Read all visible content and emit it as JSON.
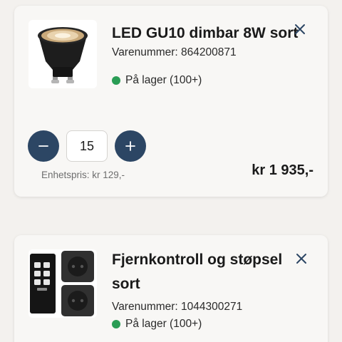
{
  "cart": {
    "items": [
      {
        "title": "LED GU10 dimbar 8W sort",
        "sku_label": "Varenummer: 864200871",
        "stock_text": "På lager (100+)",
        "stock_color": "#2a9d55",
        "quantity": "15",
        "unit_price_label": "Enhetspris: kr 129,-",
        "total_price": "kr 1 935,-",
        "image_icon": "led-bulb-image",
        "remove_icon": "close-icon"
      },
      {
        "title": "Fjernkontroll og støpsel sort",
        "sku_label": "Varenummer: 1044300271",
        "stock_text": "På lager (100+)",
        "stock_color": "#2a9d55",
        "image_icon": "remote-socket-image",
        "remove_icon": "close-icon"
      }
    ],
    "controls": {
      "decrease_icon": "minus-icon",
      "increase_icon": "plus-icon",
      "button_color": "#2c4664"
    }
  }
}
